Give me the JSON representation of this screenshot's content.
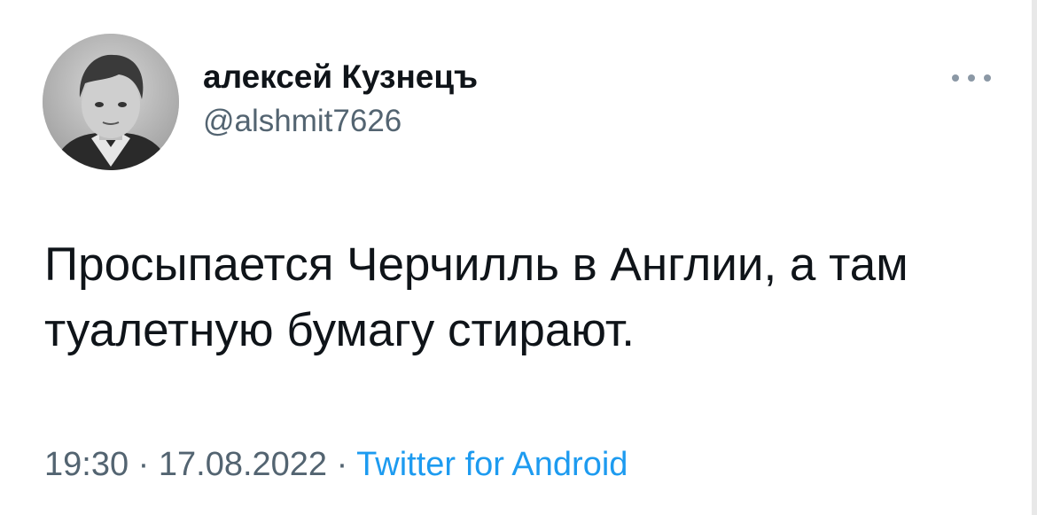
{
  "tweet": {
    "author": {
      "display_name": "алексей Кузнецъ",
      "handle": "@alshmit7626",
      "avatar": "avatar-photo-icon"
    },
    "more_icon": "more-options-icon",
    "text": "Просыпается Черчилль в Англии, а там туалетную бумагу стирают.",
    "time": "19:30",
    "date": "17.08.2022",
    "separator": "·",
    "source": "Twitter for Android"
  },
  "colors": {
    "text": "#0f1419",
    "secondary": "#536471",
    "link": "#1d9bf0",
    "background": "#ffffff"
  }
}
